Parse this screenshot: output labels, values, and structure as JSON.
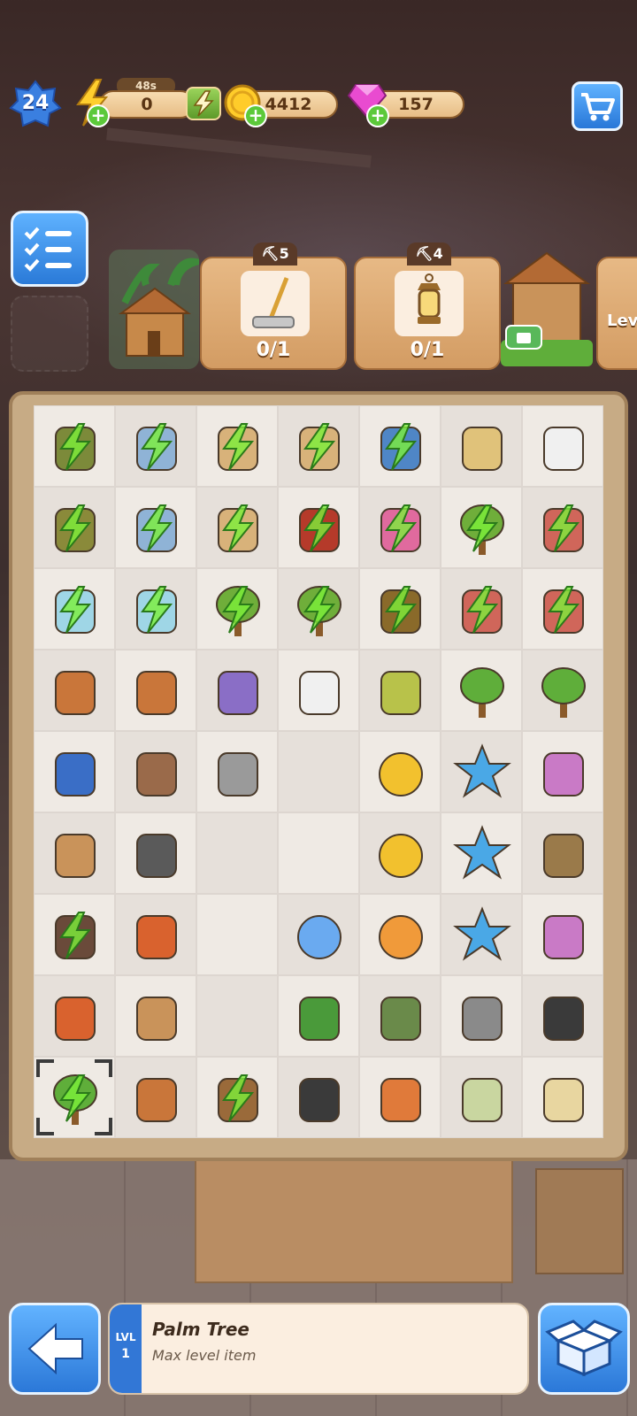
{
  "hud": {
    "level": "24",
    "energy_timer": "48s",
    "energy": "0",
    "coins": "4412",
    "gems": "157"
  },
  "orders": [
    {
      "picks": "5",
      "item_icon": "mop-icon",
      "progress": "0/1"
    },
    {
      "picks": "4",
      "item_icon": "lantern-icon",
      "progress": "0/1"
    }
  ],
  "next_order_label": "Lev",
  "board": {
    "rows": 9,
    "cols": 7,
    "cells": [
      [
        "golf-bag-icon",
        "locker-icon",
        "cabinet-icon",
        "cardboard-boxes-icon",
        "toolbox-icon",
        "vase-icon",
        "lamp-vase-icon"
      ],
      [
        "bucket-icon",
        "locker-icon",
        "wooden-crate-icon",
        "tool-caddy-icon",
        "flower-pot-icon",
        "shrub-icon",
        "toy-car-icon"
      ],
      [
        "water-bowl-icon",
        "water-bowl-icon",
        "small-tree-icon",
        "small-tree-icon",
        "tool-bucket-icon",
        "toy-car-icon",
        "toy-car-icon"
      ],
      [
        "clay-pot-icon",
        "clay-pot-icon",
        "paint-can-icon",
        "glue-tube-icon",
        "seeds-icon",
        "sprout-icon",
        "sapling-icon"
      ],
      [
        "treasure-chest-icon",
        "gloves-icon",
        "axe-icon",
        "",
        "coins-icon",
        "blue-star-icon",
        "harness-bag-icon"
      ],
      [
        "hourglass-icon",
        "rake-icon",
        "",
        "",
        "coins-icon",
        "blue-star-icon",
        "seed-pot-icon"
      ],
      [
        "wheelbarrow-icon",
        "paint-bucket-icon",
        "",
        "energy-orb-icon",
        "energy-orb-orange-icon",
        "blue-star-icon",
        "harness-bag-icon"
      ],
      [
        "screwdriver-icon",
        "mallet-icon",
        "",
        "pruners-icon",
        "hatchet-icon",
        "screws-icon",
        "shovel-icon"
      ],
      [
        "palm-tree-icon",
        "broken-pot-icon",
        "logs-icon",
        "trowel-icon",
        "paint-brush-icon",
        "garden-gloves-icon",
        "soap-icon"
      ]
    ],
    "locked": [
      [
        true,
        true,
        true,
        true,
        true,
        false,
        false
      ],
      [
        true,
        true,
        true,
        true,
        true,
        true,
        true
      ],
      [
        true,
        true,
        true,
        true,
        true,
        true,
        true
      ],
      [
        false,
        false,
        false,
        false,
        false,
        false,
        false
      ],
      [
        false,
        false,
        false,
        false,
        false,
        false,
        false
      ],
      [
        false,
        false,
        false,
        false,
        false,
        false,
        false
      ],
      [
        true,
        false,
        false,
        false,
        false,
        false,
        false
      ],
      [
        false,
        false,
        false,
        false,
        false,
        false,
        false
      ],
      [
        true,
        false,
        true,
        false,
        false,
        false,
        false
      ]
    ]
  },
  "selected_item": {
    "level_label": "LVL",
    "level": "1",
    "name": "Palm Tree",
    "description": "Max level item"
  }
}
